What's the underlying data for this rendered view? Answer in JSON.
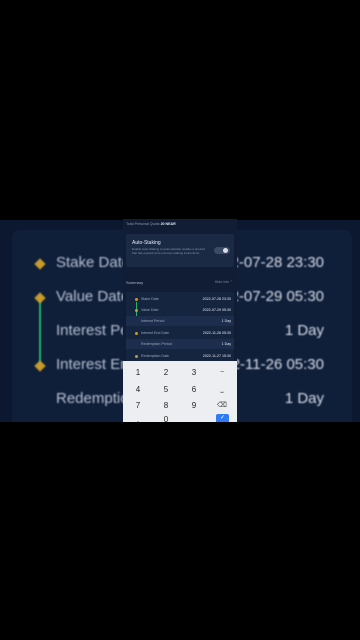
{
  "background": {
    "rows": [
      {
        "label": "Stake Date",
        "value": "2-07-28 23:30"
      },
      {
        "label": "Value Date",
        "value": "2-07-29 05:30"
      },
      {
        "label": "Interest Pe",
        "value": "1 Day"
      },
      {
        "label": "Interest En",
        "value": "2-11-26 05:30"
      },
      {
        "label": "Redemption",
        "value": "1 Day"
      }
    ]
  },
  "screen": {
    "quota_label": "Total Personal Quota",
    "quota_value": "20 NEAR",
    "auto_staking": {
      "title": "Auto-Staking",
      "description": "Enable Auto-Staking to automatically restake a product that has expired at its previous staking instructions.",
      "enabled": false
    },
    "summary_label": "Summary",
    "hide_label": "Hide info",
    "timeline": [
      {
        "label": "Stake Date",
        "value": "2022-07-28 23:30"
      },
      {
        "label": "Value Date",
        "value": "2022-07-29 05:30"
      },
      {
        "label": "Interest Period",
        "value": "1 Day"
      },
      {
        "label": "Interest End Date",
        "value": "2022-11-26 05:30"
      },
      {
        "label": "Redemption Period",
        "value": "1 Day"
      },
      {
        "label": "Redemption Date",
        "value": "2022-11-27 15:30"
      }
    ]
  },
  "keypad": {
    "keys": [
      "1",
      "2",
      "3",
      "−",
      "4",
      "5",
      "6",
      "⎵",
      "7",
      "8",
      "9",
      "⌫",
      ",",
      "0"
    ],
    "done_icon": "check-icon"
  },
  "colors": {
    "accent": "#2f7cf6",
    "timeline_active": "#23b26d",
    "dot": "#c89a2a",
    "panel": "#101d35"
  }
}
